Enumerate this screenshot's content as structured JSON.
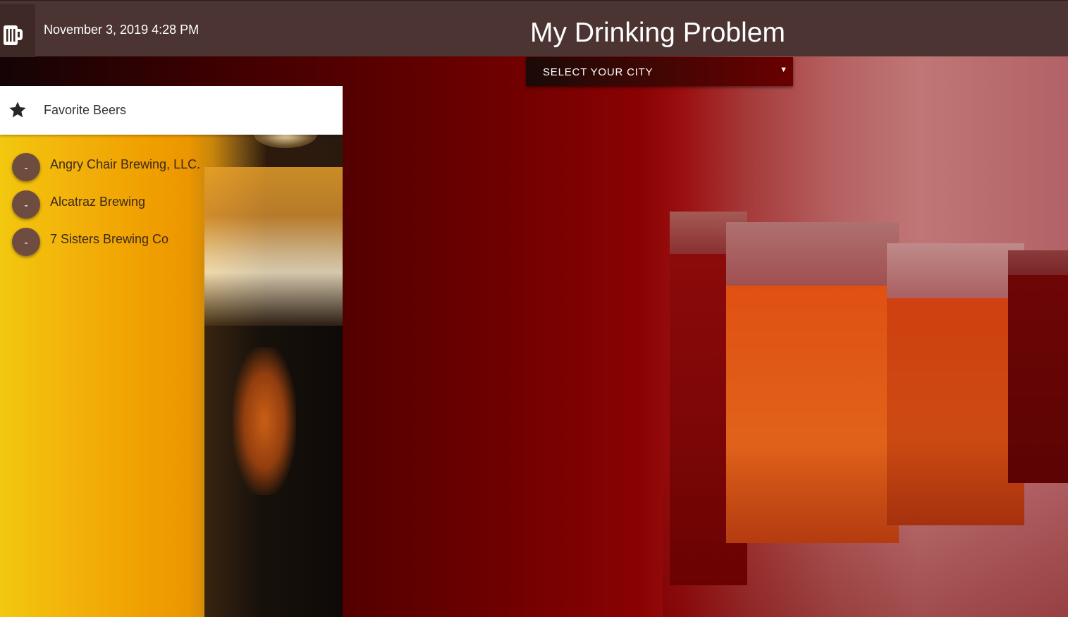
{
  "header": {
    "logo_icon": "beer-mug-icon",
    "date": "November 3, 2019 4:28 PM",
    "title": "My Drinking Problem"
  },
  "city_select": {
    "label": "SELECT YOUR CITY",
    "caret": "▼"
  },
  "favorites": {
    "title": "Favorite Beers",
    "icon": "star-icon",
    "remove_label": "-",
    "items": [
      {
        "name": "Angry Chair Brewing, LLC."
      },
      {
        "name": "Alcatraz Brewing"
      },
      {
        "name": "7 Sisters Brewing Co"
      }
    ]
  },
  "colors": {
    "header_bg": "#4b3431",
    "remove_button": "#6f4c40",
    "accent_red": "#8a0202"
  }
}
